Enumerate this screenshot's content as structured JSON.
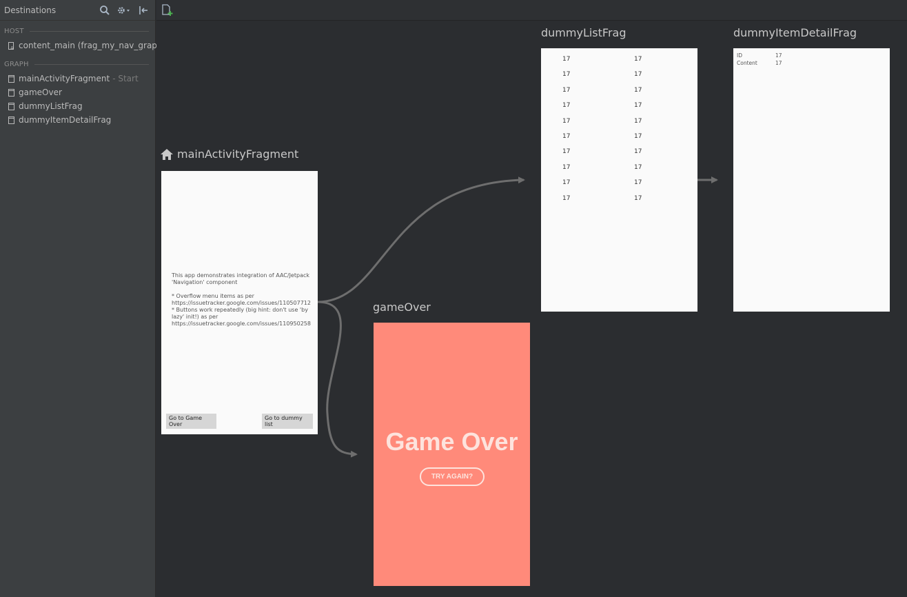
{
  "sidebar": {
    "title": "Destinations",
    "host_label": "HOST",
    "host_item": "content_main (frag_my_nav_graph)",
    "graph_label": "GRAPH",
    "items": [
      {
        "label": "mainActivityFragment",
        "suffix": "- Start"
      },
      {
        "label": "gameOver",
        "suffix": ""
      },
      {
        "label": "dummyListFrag",
        "suffix": ""
      },
      {
        "label": "dummyItemDetailFrag",
        "suffix": ""
      }
    ]
  },
  "destinations": {
    "main": {
      "title": "mainActivityFragment",
      "body": "This app demonstrates integration of AAC/Jetpack\n'Navigation' component\n\n* Overflow menu items as per\nhttps://issuetracker.google.com/issues/110507712\n* Buttons work repeatedly (big hint: don't use 'by\nlazy' init!) as per\nhttps://issuetracker.google.com/issues/110950258",
      "btn_game_over": "Go to Game Over",
      "btn_dummy_list": "Go to dummy list"
    },
    "list": {
      "title": "dummyListFrag",
      "rows": [
        [
          "17",
          "17"
        ],
        [
          "17",
          "17"
        ],
        [
          "17",
          "17"
        ],
        [
          "17",
          "17"
        ],
        [
          "17",
          "17"
        ],
        [
          "17",
          "17"
        ],
        [
          "17",
          "17"
        ],
        [
          "17",
          "17"
        ],
        [
          "17",
          "17"
        ],
        [
          "17",
          "17"
        ]
      ]
    },
    "detail": {
      "title": "dummyItemDetailFrag",
      "id_label": "ID",
      "id_value": "17",
      "content_label": "Content",
      "content_value": "17"
    },
    "gameover": {
      "title": "gameOver",
      "heading": "Game Over",
      "button": "TRY AGAIN?"
    }
  },
  "colors": {
    "canvas": "#2b2d30",
    "sidebar": "#3c3f41",
    "arrow": "#6e6e6e",
    "game_over_bg": "#ff8a7a",
    "new_destination_plus": "#4caf50"
  },
  "icons": {
    "search": "search-icon",
    "settings": "gear-icon",
    "collapse": "collapse-panel-icon",
    "new_destination": "new-destination-icon",
    "home": "home-icon",
    "host_layout": "layout-icon",
    "fragment": "fragment-icon"
  }
}
